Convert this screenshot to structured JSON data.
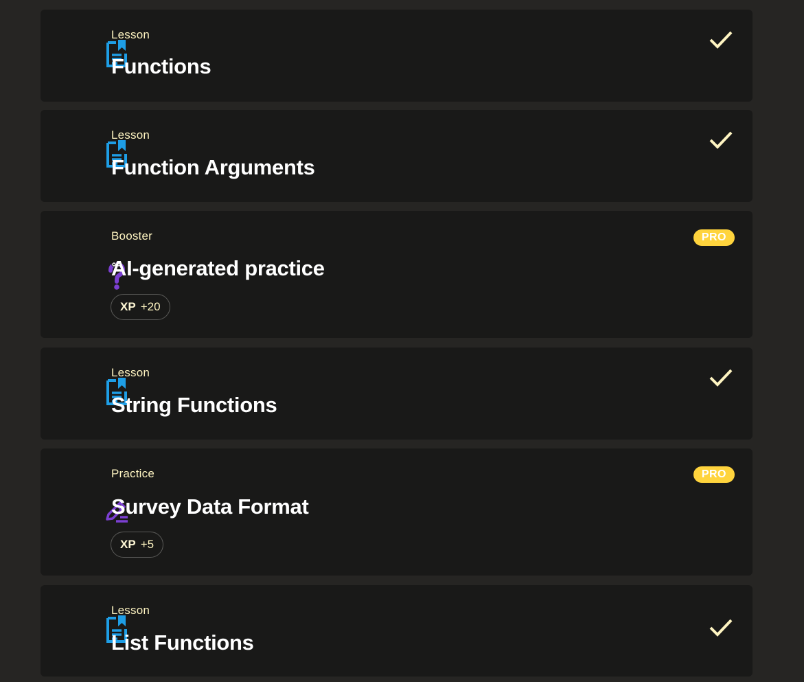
{
  "items": [
    {
      "type": "Lesson",
      "title": "Functions",
      "icon": "lesson-icon",
      "status": "completed"
    },
    {
      "type": "Lesson",
      "title": "Function Arguments",
      "icon": "lesson-icon",
      "status": "completed"
    },
    {
      "type": "Booster",
      "title": "AI-generated practice",
      "icon": "question-mark-icon",
      "badge": "PRO",
      "xp_label": "XP",
      "xp_value": "+20"
    },
    {
      "type": "Lesson",
      "title": "String Functions",
      "icon": "lesson-icon",
      "status": "completed"
    },
    {
      "type": "Practice",
      "title": "Survey Data Format",
      "icon": "pencil-icon",
      "badge": "PRO",
      "xp_label": "XP",
      "xp_value": "+5"
    },
    {
      "type": "Lesson",
      "title": "List Functions",
      "icon": "lesson-icon",
      "status": "completed"
    }
  ],
  "colors": {
    "lesson_icon": "#1e9ee6",
    "booster_icon": "#7b3fd1",
    "practice_icon": "#7b3fd1",
    "check": "#fff5c2",
    "pro_badge": "#ffd43d"
  }
}
